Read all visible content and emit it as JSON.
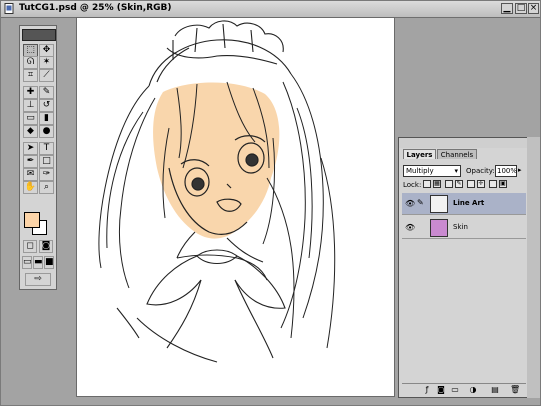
{
  "window": {
    "title": "TutCG1.psd @ 25% (Skin,RGB)",
    "doc_icon": "document-icon",
    "controls": [
      "minimize-icon",
      "zoom-icon",
      "close-icon"
    ]
  },
  "canvas": {
    "content": "anime maid girl line-art illustration with peach skin color layer"
  },
  "toolbox": {
    "header_icon": "photoshop-eye-icon",
    "tools": [
      [
        "marquee-tool-icon",
        "move-tool-icon"
      ],
      [
        "lasso-tool-icon",
        "magic-wand-tool-icon"
      ],
      [
        "crop-tool-icon",
        "slice-tool-icon"
      ],
      [
        "healing-brush-tool-icon",
        "brush-tool-icon"
      ],
      [
        "clone-stamp-tool-icon",
        "history-brush-tool-icon"
      ],
      [
        "eraser-tool-icon",
        "gradient-tool-icon"
      ],
      [
        "blur-tool-icon",
        "dodge-tool-icon"
      ],
      [
        "path-selection-tool-icon",
        "type-tool-icon"
      ],
      [
        "pen-tool-icon",
        "shape-tool-icon"
      ],
      [
        "notes-tool-icon",
        "eyedropper-tool-icon"
      ],
      [
        "hand-tool-icon",
        "zoom-tool-icon"
      ]
    ],
    "foreground_color": "#fcd4a8",
    "background_color": "#ffffff",
    "mode_icons": [
      "standard-mode-icon",
      "quick-mask-mode-icon"
    ],
    "screen_icons": [
      "standard-screen-icon",
      "full-screen-menu-icon",
      "full-screen-icon"
    ],
    "jump_icon": "jump-to-imageready-icon"
  },
  "layers_panel": {
    "tabs": [
      "Layers",
      "Channels"
    ],
    "blend_mode": "Multiply",
    "opacity_label": "Opacity:",
    "opacity_value": "100%",
    "lock_label": "Lock:",
    "layers": [
      {
        "name": "Line Art",
        "active": true,
        "thumb_color": "#f2f2f2"
      },
      {
        "name": "Skin",
        "active": false,
        "thumb_color": "#c98ad0"
      }
    ],
    "bottom_icons": [
      "layer-style-icon",
      "layer-mask-icon",
      "new-set-icon",
      "adjustment-layer-icon",
      "new-layer-icon",
      "trash-icon"
    ]
  }
}
